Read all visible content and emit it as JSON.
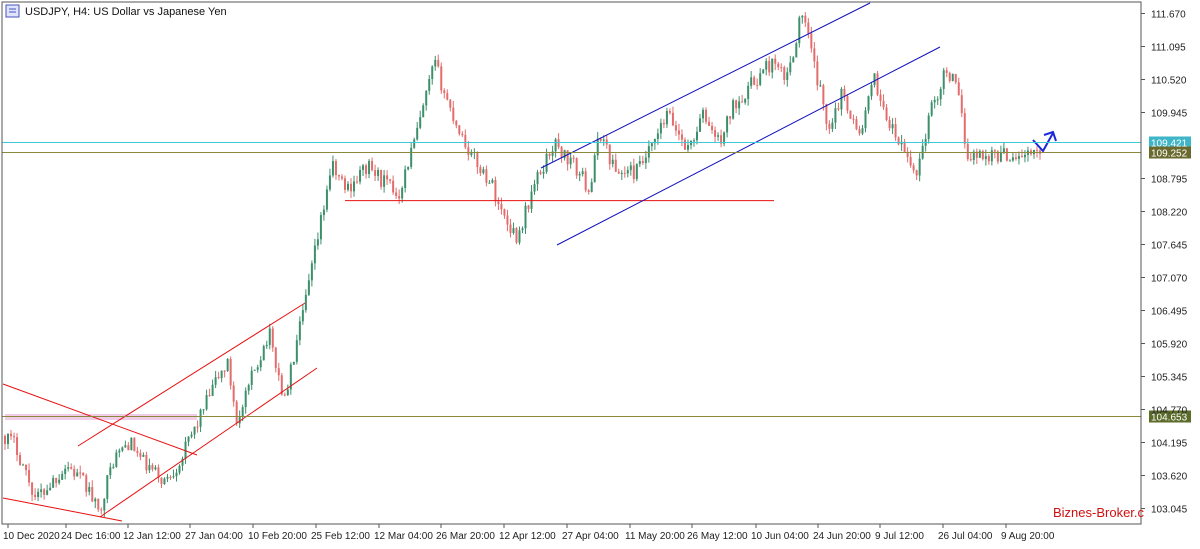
{
  "window": {
    "title": "USDJPY, H4:  US Dollar vs Japanese Yen",
    "icon": "chart-window-icon"
  },
  "watermark": "Biznes-Broker.c",
  "colors": {
    "background": "#ffffff",
    "bull": "#3c8f6b",
    "bear": "#e36c6c",
    "axis": "#555555",
    "cyan_level": "#40c8d8",
    "olive_level": "#8a8a3a",
    "cyan_tag_bg": "#3fb6c7",
    "olive_tag_bg": "#6a6a2e",
    "olive2_tag_bg": "#5b6b2a",
    "channel_red": "#e81010",
    "channel_blue": "#1010c0",
    "arrow_blue": "#1a2ad8",
    "pink_zone": "#f0c8e8",
    "watermark": "#d01010"
  },
  "chart_data": {
    "type": "candlestick",
    "title": "USDJPY, H4:  US Dollar vs Japanese Yen",
    "symbol": "USDJPY",
    "timeframe": "H4",
    "ylim": [
      102.85,
      111.85
    ],
    "y_ticks": [
      "111.670",
      "111.095",
      "110.520",
      "109.945",
      "108.795",
      "108.220",
      "107.645",
      "107.070",
      "106.495",
      "105.920",
      "105.345",
      "104.770",
      "104.195",
      "103.620",
      "103.045"
    ],
    "x_ticks": [
      "10 Dec 2020",
      "24 Dec 16:00",
      "12 Jan 12:00",
      "27 Jan 04:00",
      "10 Feb 20:00",
      "25 Feb 12:00",
      "12 Mar 04:00",
      "26 Mar 20:00",
      "12 Apr 12:00",
      "27 Apr 04:00",
      "11 May 20:00",
      "26 May 12:00",
      "10 Jun 04:00",
      "24 Jun 20:00",
      "9 Jul 12:00",
      "26 Jul 04:00",
      "9 Aug 20:00"
    ],
    "price_levels": [
      {
        "label": "109.421",
        "value": 109.421,
        "style": "cyan"
      },
      {
        "label": "109.252",
        "value": 109.252,
        "style": "olive"
      },
      {
        "label": "104.653",
        "value": 104.653,
        "style": "olive2"
      }
    ],
    "path_anchors": [
      {
        "t": 0,
        "p": 104.3
      },
      {
        "t": 0.01,
        "p": 104.15
      },
      {
        "t": 0.03,
        "p": 103.2
      },
      {
        "t": 0.06,
        "p": 103.8
      },
      {
        "t": 0.08,
        "p": 103.4
      },
      {
        "t": 0.09,
        "p": 102.95
      },
      {
        "t": 0.105,
        "p": 103.9
      },
      {
        "t": 0.12,
        "p": 104.2
      },
      {
        "t": 0.135,
        "p": 103.8
      },
      {
        "t": 0.155,
        "p": 103.5
      },
      {
        "t": 0.17,
        "p": 103.9
      },
      {
        "t": 0.185,
        "p": 104.5
      },
      {
        "t": 0.205,
        "p": 105.3
      },
      {
        "t": 0.215,
        "p": 105.55
      },
      {
        "t": 0.225,
        "p": 104.5
      },
      {
        "t": 0.24,
        "p": 105.4
      },
      {
        "t": 0.255,
        "p": 106.1
      },
      {
        "t": 0.27,
        "p": 104.9
      },
      {
        "t": 0.29,
        "p": 106.6
      },
      {
        "t": 0.305,
        "p": 108.0
      },
      {
        "t": 0.315,
        "p": 109.0
      },
      {
        "t": 0.33,
        "p": 108.6
      },
      {
        "t": 0.35,
        "p": 109.0
      },
      {
        "t": 0.38,
        "p": 108.5
      },
      {
        "t": 0.4,
        "p": 109.7
      },
      {
        "t": 0.415,
        "p": 110.8
      },
      {
        "t": 0.43,
        "p": 110.0
      },
      {
        "t": 0.45,
        "p": 109.2
      },
      {
        "t": 0.47,
        "p": 108.7
      },
      {
        "t": 0.48,
        "p": 108.2
      },
      {
        "t": 0.495,
        "p": 107.75
      },
      {
        "t": 0.51,
        "p": 108.6
      },
      {
        "t": 0.53,
        "p": 109.4
      },
      {
        "t": 0.55,
        "p": 109.0
      },
      {
        "t": 0.565,
        "p": 108.6
      },
      {
        "t": 0.575,
        "p": 109.6
      },
      {
        "t": 0.59,
        "p": 108.9
      },
      {
        "t": 0.61,
        "p": 108.9
      },
      {
        "t": 0.625,
        "p": 109.3
      },
      {
        "t": 0.64,
        "p": 109.9
      },
      {
        "t": 0.66,
        "p": 109.3
      },
      {
        "t": 0.675,
        "p": 109.9
      },
      {
        "t": 0.69,
        "p": 109.4
      },
      {
        "t": 0.705,
        "p": 110.1
      },
      {
        "t": 0.72,
        "p": 110.4
      },
      {
        "t": 0.74,
        "p": 110.8
      },
      {
        "t": 0.755,
        "p": 110.5
      },
      {
        "t": 0.77,
        "p": 111.7
      },
      {
        "t": 0.785,
        "p": 110.5
      },
      {
        "t": 0.795,
        "p": 109.7
      },
      {
        "t": 0.81,
        "p": 110.3
      },
      {
        "t": 0.825,
        "p": 109.5
      },
      {
        "t": 0.84,
        "p": 110.5
      },
      {
        "t": 0.855,
        "p": 109.7
      },
      {
        "t": 0.87,
        "p": 109.2
      },
      {
        "t": 0.88,
        "p": 108.85
      },
      {
        "t": 0.895,
        "p": 110.0
      },
      {
        "t": 0.91,
        "p": 110.7
      },
      {
        "t": 0.92,
        "p": 110.3
      },
      {
        "t": 0.93,
        "p": 109.2
      }
    ],
    "drawn_objects": [
      {
        "kind": "channel",
        "color": "red"
      },
      {
        "kind": "channel",
        "color": "red"
      },
      {
        "kind": "wedge",
        "color": "red"
      },
      {
        "kind": "horizontal-segment",
        "color": "red",
        "value": 108.4
      },
      {
        "kind": "channel",
        "color": "blue"
      },
      {
        "kind": "arrow",
        "color": "blue"
      },
      {
        "kind": "zone",
        "color": "pink",
        "value": 104.2
      }
    ]
  }
}
